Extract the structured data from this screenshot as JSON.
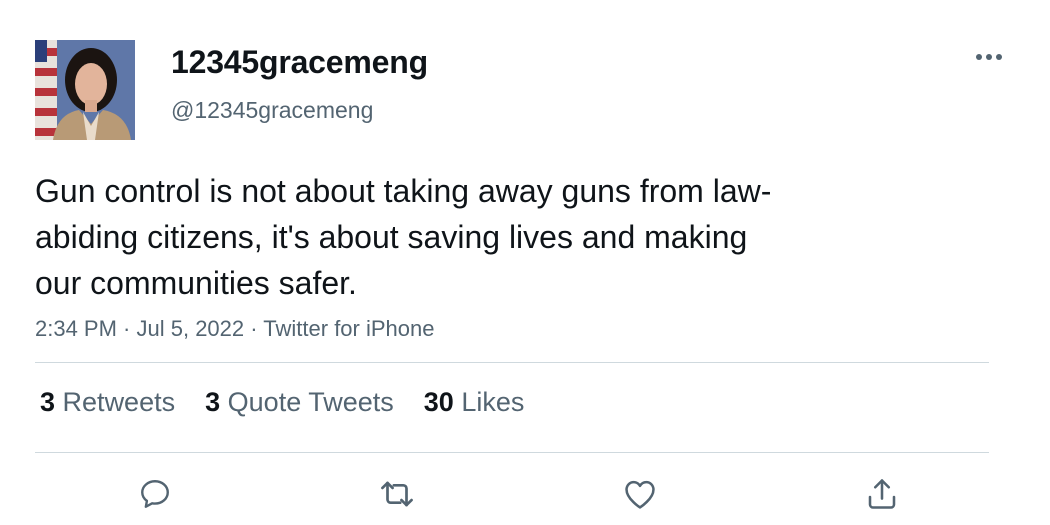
{
  "author": {
    "display_name": "12345gracemeng",
    "handle": "@12345gracemeng"
  },
  "tweet": {
    "text_lines": [
      "Gun control is not about taking away guns from law-",
      "abiding citizens, it's about saving lives and making",
      "our communities safer."
    ],
    "time": "2:34 PM",
    "date": "Jul 5, 2022",
    "source": "Twitter for iPhone",
    "separator": " · "
  },
  "stats": {
    "retweets_count": "3",
    "retweets_label": "Retweets",
    "quotes_count": "3",
    "quotes_label": "Quote Tweets",
    "likes_count": "30",
    "likes_label": "Likes"
  },
  "icons": {
    "more": "more-icon",
    "reply": "reply-icon",
    "retweet": "retweet-icon",
    "like": "heart-icon",
    "share": "share-icon"
  },
  "colors": {
    "text_primary": "#0f1419",
    "text_secondary": "#536471",
    "divider": "#cfd9de"
  }
}
